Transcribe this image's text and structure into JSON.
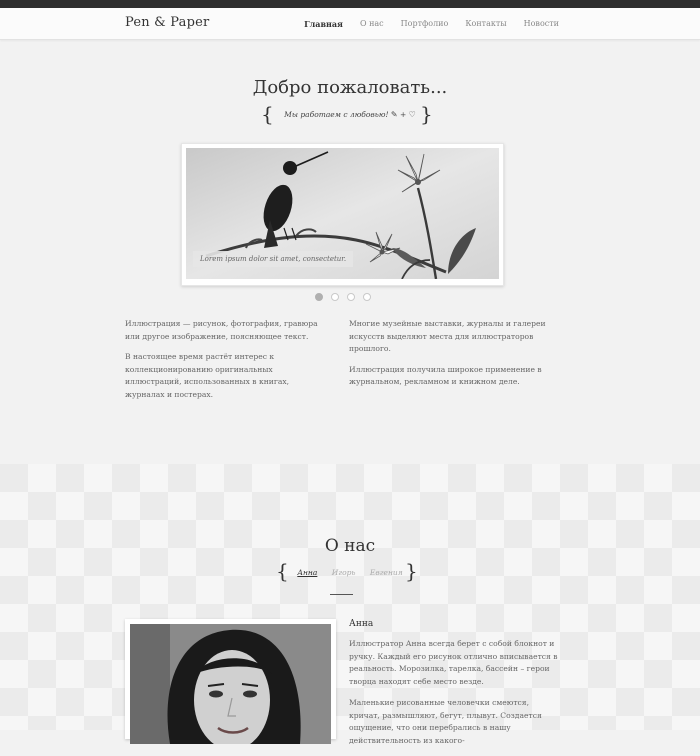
{
  "header": {
    "logo": "Pen & Paper",
    "nav": [
      "Главная",
      "О нас",
      "Портфолио",
      "Контакты",
      "Новости"
    ]
  },
  "hero": {
    "title": "Добро пожаловать...",
    "tagline": "Мы работаем с любовью!",
    "tagline_plus": "+",
    "slider_caption": "Lorem ipsum dolor sit amet, consectetur.",
    "slide_count": 4,
    "active_slide": 1
  },
  "intro": {
    "left": [
      "Иллюстрация — рисунок, фотография, гравюра или другое изображение, поясняющее текст.",
      "В настоящее время растёт интерес к коллекционированию оригинальных иллюстраций, использованных в книгах, журналах и постерах."
    ],
    "right": [
      "Многие музейные выставки, журналы и галереи искусств выделяют места для иллюстраторов прошлого.",
      "Иллюстрация получила широкое применение в журнальном, рекламном и книжном деле."
    ]
  },
  "about": {
    "title": "О нас",
    "tabs": [
      "Анна",
      "Игорь",
      "Евгения"
    ],
    "active_tab": "Анна",
    "person": {
      "name": "Анна",
      "paragraphs": [
        "Иллюстратор Анна всегда берет с собой блокнот и ручку. Каждый его рисунок отлично вписывается в реальность. Морозилка, тарелка, бассейн – герои творца находят себе место везде.",
        "Маленькие рисованные человечки смеются, кричат, размышляют, бегут, плывут. Создается ощущение, что они перебрались в нашу действительность из какого-"
      ]
    }
  },
  "colors": {
    "topbar": "#2e2e2e",
    "text_dark": "#333333",
    "text_body": "#666666",
    "background": "#f2f2f2"
  }
}
